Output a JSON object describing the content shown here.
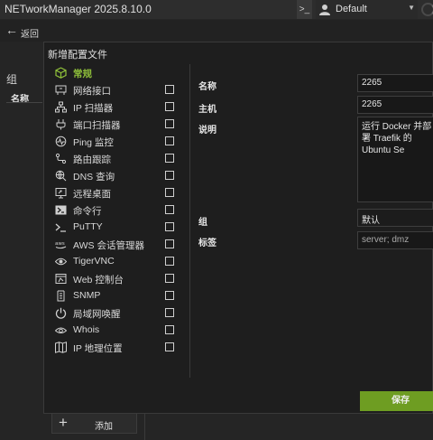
{
  "app": {
    "title": "NETworkManager 2025.8.10.0",
    "profile": "Default"
  },
  "nav": {
    "back_label": "返回"
  },
  "background": {
    "group_label": "组",
    "name_column": "名称",
    "add_label": "添加"
  },
  "dialog": {
    "title": "新增配置文件",
    "types": [
      {
        "label": "常规",
        "icon": "cube-icon",
        "active": true
      },
      {
        "label": "网络接口",
        "icon": "network-interface-icon"
      },
      {
        "label": "IP 扫描器",
        "icon": "ip-scanner-icon"
      },
      {
        "label": "端口扫描器",
        "icon": "port-scanner-icon"
      },
      {
        "label": "Ping 监控",
        "icon": "ping-monitor-icon"
      },
      {
        "label": "路由跟踪",
        "icon": "traceroute-icon"
      },
      {
        "label": "DNS 查询",
        "icon": "dns-lookup-icon"
      },
      {
        "label": "远程桌面",
        "icon": "remote-desktop-icon"
      },
      {
        "label": "命令行",
        "icon": "powershell-icon"
      },
      {
        "label": "PuTTY",
        "icon": "putty-icon"
      },
      {
        "label": "AWS 会话管理器",
        "icon": "aws-icon"
      },
      {
        "label": "TigerVNC",
        "icon": "eye-icon"
      },
      {
        "label": "Web 控制台",
        "icon": "web-console-icon"
      },
      {
        "label": "SNMP",
        "icon": "snmp-icon"
      },
      {
        "label": "局域网唤醒",
        "icon": "power-icon"
      },
      {
        "label": "Whois",
        "icon": "whois-icon"
      },
      {
        "label": "IP 地理位置",
        "icon": "map-icon"
      }
    ],
    "fields": {
      "name_label": "名称",
      "name_value": "2265",
      "host_label": "主机",
      "host_value": "2265",
      "desc_label": "说明",
      "desc_value": "运行 Docker 并部署 Traefik 的 Ubuntu Se",
      "group_label": "组",
      "group_value": "默认",
      "tags_label": "标签",
      "tags_placeholder": "server; dmz"
    },
    "save_label": "保存"
  }
}
